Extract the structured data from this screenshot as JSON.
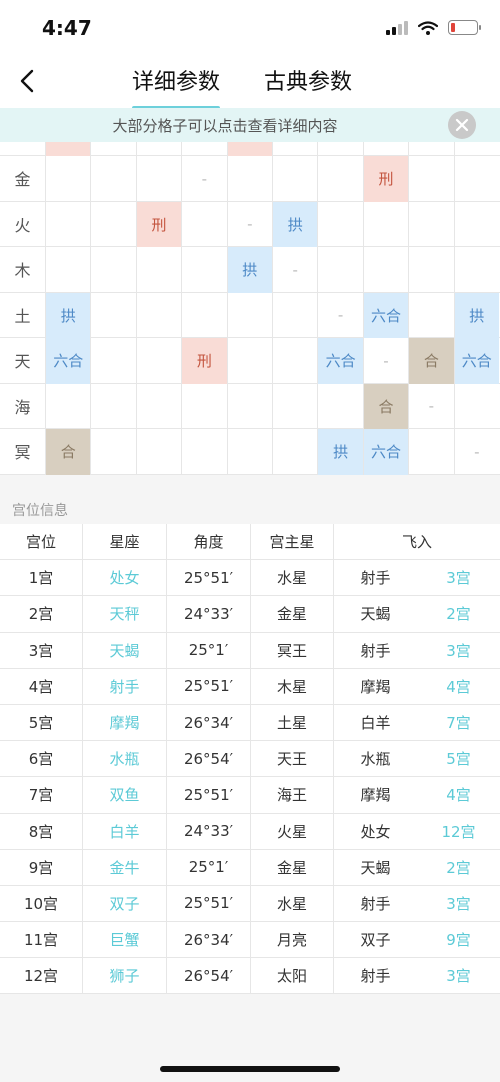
{
  "status": {
    "time": "4:47"
  },
  "nav": {
    "tabs": [
      {
        "label": "详细参数",
        "active": true
      },
      {
        "label": "古典参数",
        "active": false
      }
    ]
  },
  "notice": {
    "text": "大部分格子可以点击查看详细内容"
  },
  "aspect_grid": {
    "top_row": [
      "xing",
      "",
      "",
      "",
      "xing",
      "",
      "",
      "",
      "",
      ""
    ],
    "rows": [
      {
        "label": "金",
        "cells": [
          "",
          "",
          "",
          "-",
          "",
          "",
          "",
          "刑",
          "",
          ""
        ]
      },
      {
        "label": "火",
        "cells": [
          "",
          "",
          "刑",
          "",
          "-",
          "拱",
          "",
          "",
          "",
          ""
        ]
      },
      {
        "label": "木",
        "cells": [
          "",
          "",
          "",
          "",
          "拱",
          "-",
          "",
          "",
          "",
          ""
        ]
      },
      {
        "label": "土",
        "cells": [
          "拱",
          "",
          "",
          "",
          "",
          "",
          "-",
          "六合",
          "",
          "拱"
        ]
      },
      {
        "label": "天",
        "cells": [
          "六合",
          "",
          "",
          "刑",
          "",
          "",
          "六合",
          "-",
          "合",
          "六合"
        ]
      },
      {
        "label": "海",
        "cells": [
          "",
          "",
          "",
          "",
          "",
          "",
          "",
          "合",
          "-",
          ""
        ]
      },
      {
        "label": "冥",
        "cells": [
          "合",
          "",
          "",
          "",
          "",
          "",
          "拱",
          "六合",
          "",
          "-"
        ]
      }
    ]
  },
  "houses": {
    "title": "宫位信息",
    "headers": [
      "宫位",
      "星座",
      "角度",
      "宫主星",
      "飞入"
    ],
    "rows": [
      [
        "1宫",
        "处女",
        "25°51′",
        "水星",
        "射手",
        "3宫"
      ],
      [
        "2宫",
        "天秤",
        "24°33′",
        "金星",
        "天蝎",
        "2宫"
      ],
      [
        "3宫",
        "天蝎",
        "25°1′",
        "冥王",
        "射手",
        "3宫"
      ],
      [
        "4宫",
        "射手",
        "25°51′",
        "木星",
        "摩羯",
        "4宫"
      ],
      [
        "5宫",
        "摩羯",
        "26°34′",
        "土星",
        "白羊",
        "7宫"
      ],
      [
        "6宫",
        "水瓶",
        "26°54′",
        "天王",
        "水瓶",
        "5宫"
      ],
      [
        "7宫",
        "双鱼",
        "25°51′",
        "海王",
        "摩羯",
        "4宫"
      ],
      [
        "8宫",
        "白羊",
        "24°33′",
        "火星",
        "处女",
        "12宫"
      ],
      [
        "9宫",
        "金牛",
        "25°1′",
        "金星",
        "天蝎",
        "2宫"
      ],
      [
        "10宫",
        "双子",
        "25°51′",
        "水星",
        "射手",
        "3宫"
      ],
      [
        "11宫",
        "巨蟹",
        "26°34′",
        "月亮",
        "双子",
        "9宫"
      ],
      [
        "12宫",
        "狮子",
        "26°54′",
        "太阳",
        "射手",
        "3宫"
      ]
    ]
  },
  "colors": {
    "accent": "#6dd0db",
    "xing": "#f9dcd6",
    "gong": "#d7ebfb",
    "he": "#d8cfc0"
  }
}
